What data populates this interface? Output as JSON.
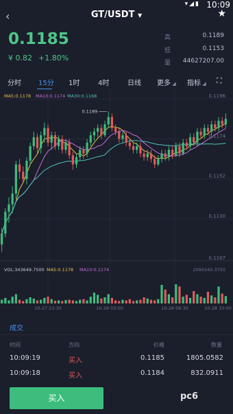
{
  "status_bar": {
    "time": "10:09"
  },
  "header": {
    "back_icon": "chevron-left-icon",
    "title": "GT/USDT",
    "title_caret": "▼",
    "star_icon": "star-icon"
  },
  "price": {
    "last": "0.1185",
    "cny": "¥ 0.82",
    "change": "+1.80%"
  },
  "stats": [
    {
      "label": "高",
      "value": "0.1189"
    },
    {
      "label": "低",
      "value": "0.1153"
    },
    {
      "label": "量",
      "value": "44627207.00"
    }
  ],
  "tabs": [
    {
      "label": "分时"
    },
    {
      "label": "15分"
    },
    {
      "label": "1时"
    },
    {
      "label": "4时"
    },
    {
      "label": "日线"
    },
    {
      "label": "更多"
    },
    {
      "label": "指标"
    }
  ],
  "active_tab": "15分",
  "chart_data": {
    "type": "candlestick",
    "ma_legend": [
      {
        "label": "MA5:0.1178",
        "color": "#e8c14a"
      },
      {
        "label": "MA10:0.1174",
        "color": "#c66fd8"
      },
      {
        "label": "MA30:0.1168",
        "color": "#4fc5b8"
      }
    ],
    "price_axis": [
      "0.1196",
      "0.1174",
      "0.1152",
      "0.1130",
      "0.1107"
    ],
    "ylim": [
      0.1107,
      0.1196
    ],
    "high_marker": "0.1189",
    "volume_legend": [
      {
        "label": "VOL:343649.7500",
        "color": "#c9cfdd"
      },
      {
        "label": "MA5:0.1178",
        "color": "#e8c14a"
      },
      {
        "label": "MA10:0.1174",
        "color": "#c66fd8"
      }
    ],
    "volume_axis_max": "2095540.3750",
    "time_axis": [
      "10-27 23:30",
      "10-28 03:00",
      "10-28 06:30",
      "10-28 10:00"
    ],
    "candles": [
      [
        0.1116,
        0.1122,
        0.1112,
        0.1125
      ],
      [
        0.1122,
        0.1134,
        0.112,
        0.1136
      ],
      [
        0.1134,
        0.1138,
        0.1128,
        0.1142
      ],
      [
        0.1138,
        0.1144,
        0.1133,
        0.1148
      ],
      [
        0.1144,
        0.116,
        0.1141,
        0.1162
      ],
      [
        0.116,
        0.1156,
        0.1152,
        0.1163
      ],
      [
        0.1156,
        0.1152,
        0.115,
        0.1159
      ],
      [
        0.1152,
        0.1162,
        0.1149,
        0.1164
      ],
      [
        0.1162,
        0.117,
        0.116,
        0.1172
      ],
      [
        0.117,
        0.1175,
        0.1168,
        0.1178
      ],
      [
        0.1175,
        0.1169,
        0.1166,
        0.1177
      ],
      [
        0.1169,
        0.1176,
        0.1166,
        0.1178
      ],
      [
        0.1176,
        0.118,
        0.1172,
        0.1183
      ],
      [
        0.118,
        0.1172,
        0.117,
        0.1182
      ],
      [
        0.1172,
        0.1176,
        0.1168,
        0.1178
      ],
      [
        0.1176,
        0.117,
        0.1168,
        0.1178
      ],
      [
        0.117,
        0.1174,
        0.1168,
        0.1176
      ],
      [
        0.1174,
        0.1168,
        0.1166,
        0.1176
      ],
      [
        0.1168,
        0.1172,
        0.1166,
        0.1174
      ],
      [
        0.1172,
        0.1165,
        0.1163,
        0.1174
      ],
      [
        0.1165,
        0.116,
        0.1157,
        0.1167
      ],
      [
        0.116,
        0.1164,
        0.1158,
        0.1166
      ],
      [
        0.1164,
        0.1168,
        0.1162,
        0.117
      ],
      [
        0.1168,
        0.1166,
        0.1163,
        0.117
      ],
      [
        0.1166,
        0.1172,
        0.1164,
        0.1174
      ],
      [
        0.1172,
        0.1176,
        0.117,
        0.1178
      ],
      [
        0.1176,
        0.1178,
        0.1173,
        0.118
      ],
      [
        0.1178,
        0.118,
        0.1175,
        0.1182
      ],
      [
        0.118,
        0.1176,
        0.1174,
        0.1182
      ],
      [
        0.1176,
        0.1182,
        0.1175,
        0.1184
      ],
      [
        0.1182,
        0.1186,
        0.118,
        0.1189
      ],
      [
        0.1186,
        0.118,
        0.1178,
        0.1188
      ],
      [
        0.118,
        0.1178,
        0.1176,
        0.1182
      ],
      [
        0.1178,
        0.1174,
        0.1172,
        0.118
      ],
      [
        0.1174,
        0.1176,
        0.1172,
        0.1178
      ],
      [
        0.1176,
        0.1172,
        0.117,
        0.1178
      ],
      [
        0.1172,
        0.117,
        0.1168,
        0.1174
      ],
      [
        0.117,
        0.1168,
        0.1166,
        0.1172
      ],
      [
        0.1168,
        0.117,
        0.1166,
        0.1172
      ],
      [
        0.117,
        0.1166,
        0.1164,
        0.1172
      ],
      [
        0.1166,
        0.1164,
        0.1162,
        0.1168
      ],
      [
        0.1164,
        0.1166,
        0.1162,
        0.1168
      ],
      [
        0.1166,
        0.1163,
        0.1161,
        0.1168
      ],
      [
        0.1163,
        0.116,
        0.1158,
        0.1165
      ],
      [
        0.116,
        0.1163,
        0.1159,
        0.1165
      ],
      [
        0.1163,
        0.1166,
        0.1161,
        0.1168
      ],
      [
        0.1166,
        0.1164,
        0.1162,
        0.1168
      ],
      [
        0.1164,
        0.1168,
        0.1162,
        0.117
      ],
      [
        0.1168,
        0.1165,
        0.1163,
        0.117
      ],
      [
        0.1165,
        0.117,
        0.1164,
        0.1172
      ],
      [
        0.117,
        0.1166,
        0.1164,
        0.1172
      ],
      [
        0.1166,
        0.1172,
        0.1165,
        0.1174
      ],
      [
        0.1172,
        0.117,
        0.1168,
        0.1174
      ],
      [
        0.117,
        0.1175,
        0.1168,
        0.1177
      ],
      [
        0.1175,
        0.1172,
        0.117,
        0.1177
      ],
      [
        0.1172,
        0.1178,
        0.117,
        0.118
      ],
      [
        0.1178,
        0.1176,
        0.1174,
        0.118
      ],
      [
        0.1176,
        0.118,
        0.1174,
        0.1182
      ],
      [
        0.118,
        0.1178,
        0.1176,
        0.1182
      ],
      [
        0.1178,
        0.1182,
        0.1176,
        0.1184
      ],
      [
        0.1182,
        0.118,
        0.1178,
        0.1184
      ],
      [
        0.118,
        0.1184,
        0.1178,
        0.1186
      ],
      [
        0.1184,
        0.1182,
        0.118,
        0.1186
      ],
      [
        0.1182,
        0.1185,
        0.118,
        0.1188
      ]
    ],
    "volumes": [
      0.12,
      0.18,
      0.1,
      0.22,
      0.3,
      0.12,
      0.08,
      0.14,
      0.2,
      0.16,
      0.1,
      0.12,
      0.18,
      0.22,
      0.14,
      0.09,
      0.1,
      0.08,
      0.11,
      0.12,
      0.1,
      0.08,
      0.12,
      0.14,
      0.1,
      0.22,
      0.35,
      0.28,
      0.16,
      0.2,
      0.3,
      0.18,
      0.1,
      0.08,
      0.12,
      0.1,
      0.14,
      0.08,
      0.1,
      0.12,
      0.2,
      0.16,
      0.12,
      0.1,
      0.14,
      0.6,
      0.45,
      0.3,
      0.2,
      0.62,
      0.55,
      0.22,
      0.28,
      0.18,
      0.4,
      0.3,
      0.22,
      0.18,
      0.38,
      0.26,
      0.2,
      0.55,
      0.32,
      0.24
    ]
  },
  "trades": {
    "title": "成交",
    "headers": {
      "time": "时间",
      "direction": "方向",
      "price": "价格",
      "amount": "数量"
    },
    "rows": [
      {
        "time": "10:09:19",
        "direction": "买入",
        "price": "0.1185",
        "amount": "1805.0582"
      },
      {
        "time": "10:09:18",
        "direction": "买入",
        "price": "0.1184",
        "amount": "832.0911"
      }
    ]
  },
  "buy_button": "买入",
  "watermark": "pc6"
}
